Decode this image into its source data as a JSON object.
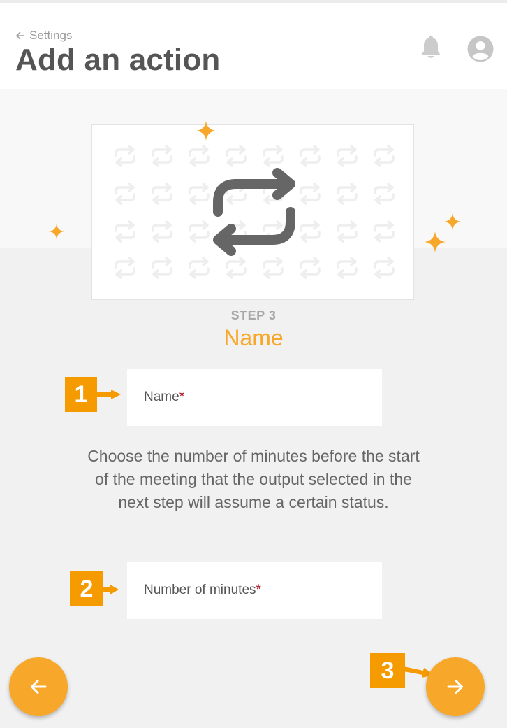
{
  "header": {
    "back_label": "Settings",
    "title": "Add an action",
    "notifications_icon": "bell-icon",
    "account_icon": "user-circle-icon"
  },
  "illustration": {
    "icon": "repeat-icon",
    "pattern_icon": "repeat-icon",
    "decorations": "sparkle-icon"
  },
  "step": {
    "label": "STEP 3",
    "title": "Name"
  },
  "form": {
    "name_field": {
      "label": "Name",
      "required_mark": "*",
      "value": ""
    },
    "description": "Choose the number of minutes before the start of the meeting that the output selected in the next step will assume a certain status.",
    "minutes_field": {
      "label": "Number of minutes",
      "required_mark": "*",
      "value": ""
    }
  },
  "navigation": {
    "prev_icon": "arrow-left-icon",
    "next_icon": "arrow-right-icon"
  },
  "callouts": [
    "1",
    "2",
    "3"
  ],
  "colors": {
    "accent": "#f7a82a",
    "callout": "#f59b00",
    "required": "#b0162b",
    "title_text": "#555555"
  }
}
